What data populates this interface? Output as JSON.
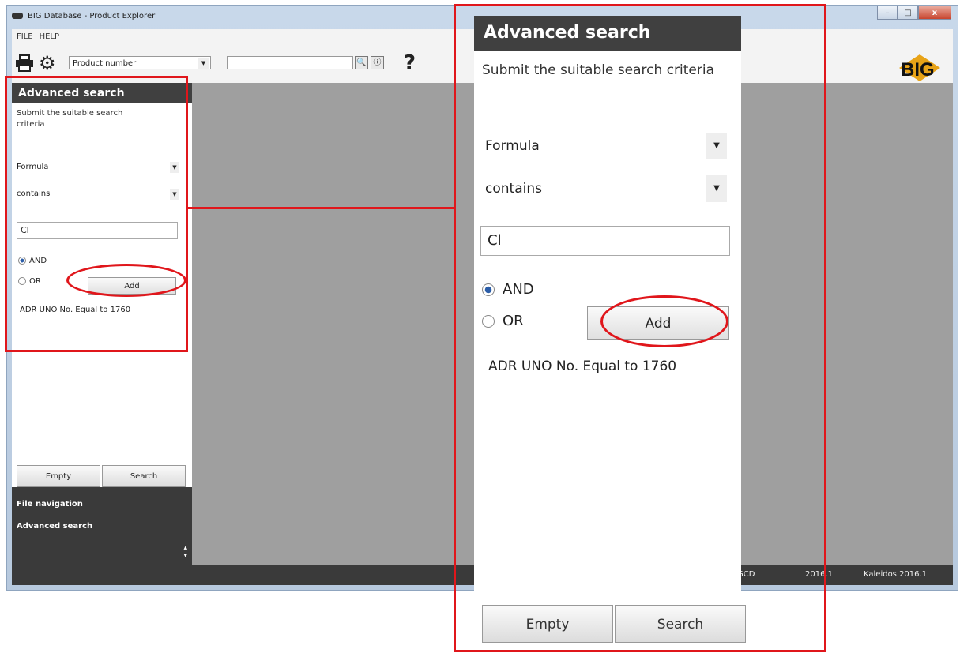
{
  "window": {
    "title": "BIG Database - Product Explorer",
    "controls": [
      "–",
      "□",
      "x"
    ]
  },
  "menu": {
    "file": "FILE",
    "help": "HELP"
  },
  "toolbar": {
    "search_field_select": "Product number",
    "help_glyph": "?",
    "logo_text": "BIG"
  },
  "status": {
    "gcd": "GCD",
    "version": "2016.1",
    "kaleidos": "Kaleidos 2016.1"
  },
  "nav": {
    "file_navigation": "File navigation",
    "advanced_search": "Advanced search"
  },
  "panel": {
    "title": "Advanced search",
    "subtitle": "Submit the suitable search criteria",
    "field_select": "Formula",
    "operator_select": "contains",
    "value_input": "Cl",
    "radio_and": "AND",
    "radio_or": "OR",
    "selected_operator": "AND",
    "add_label": "Add",
    "criteria": "ADR UNO No. Equal to 1760",
    "empty_label": "Empty",
    "search_label": "Search"
  },
  "colors": {
    "annotation": "#e0161b",
    "header": "#404040",
    "workspace": "#9f9f9f",
    "logo": "#e8a317"
  }
}
